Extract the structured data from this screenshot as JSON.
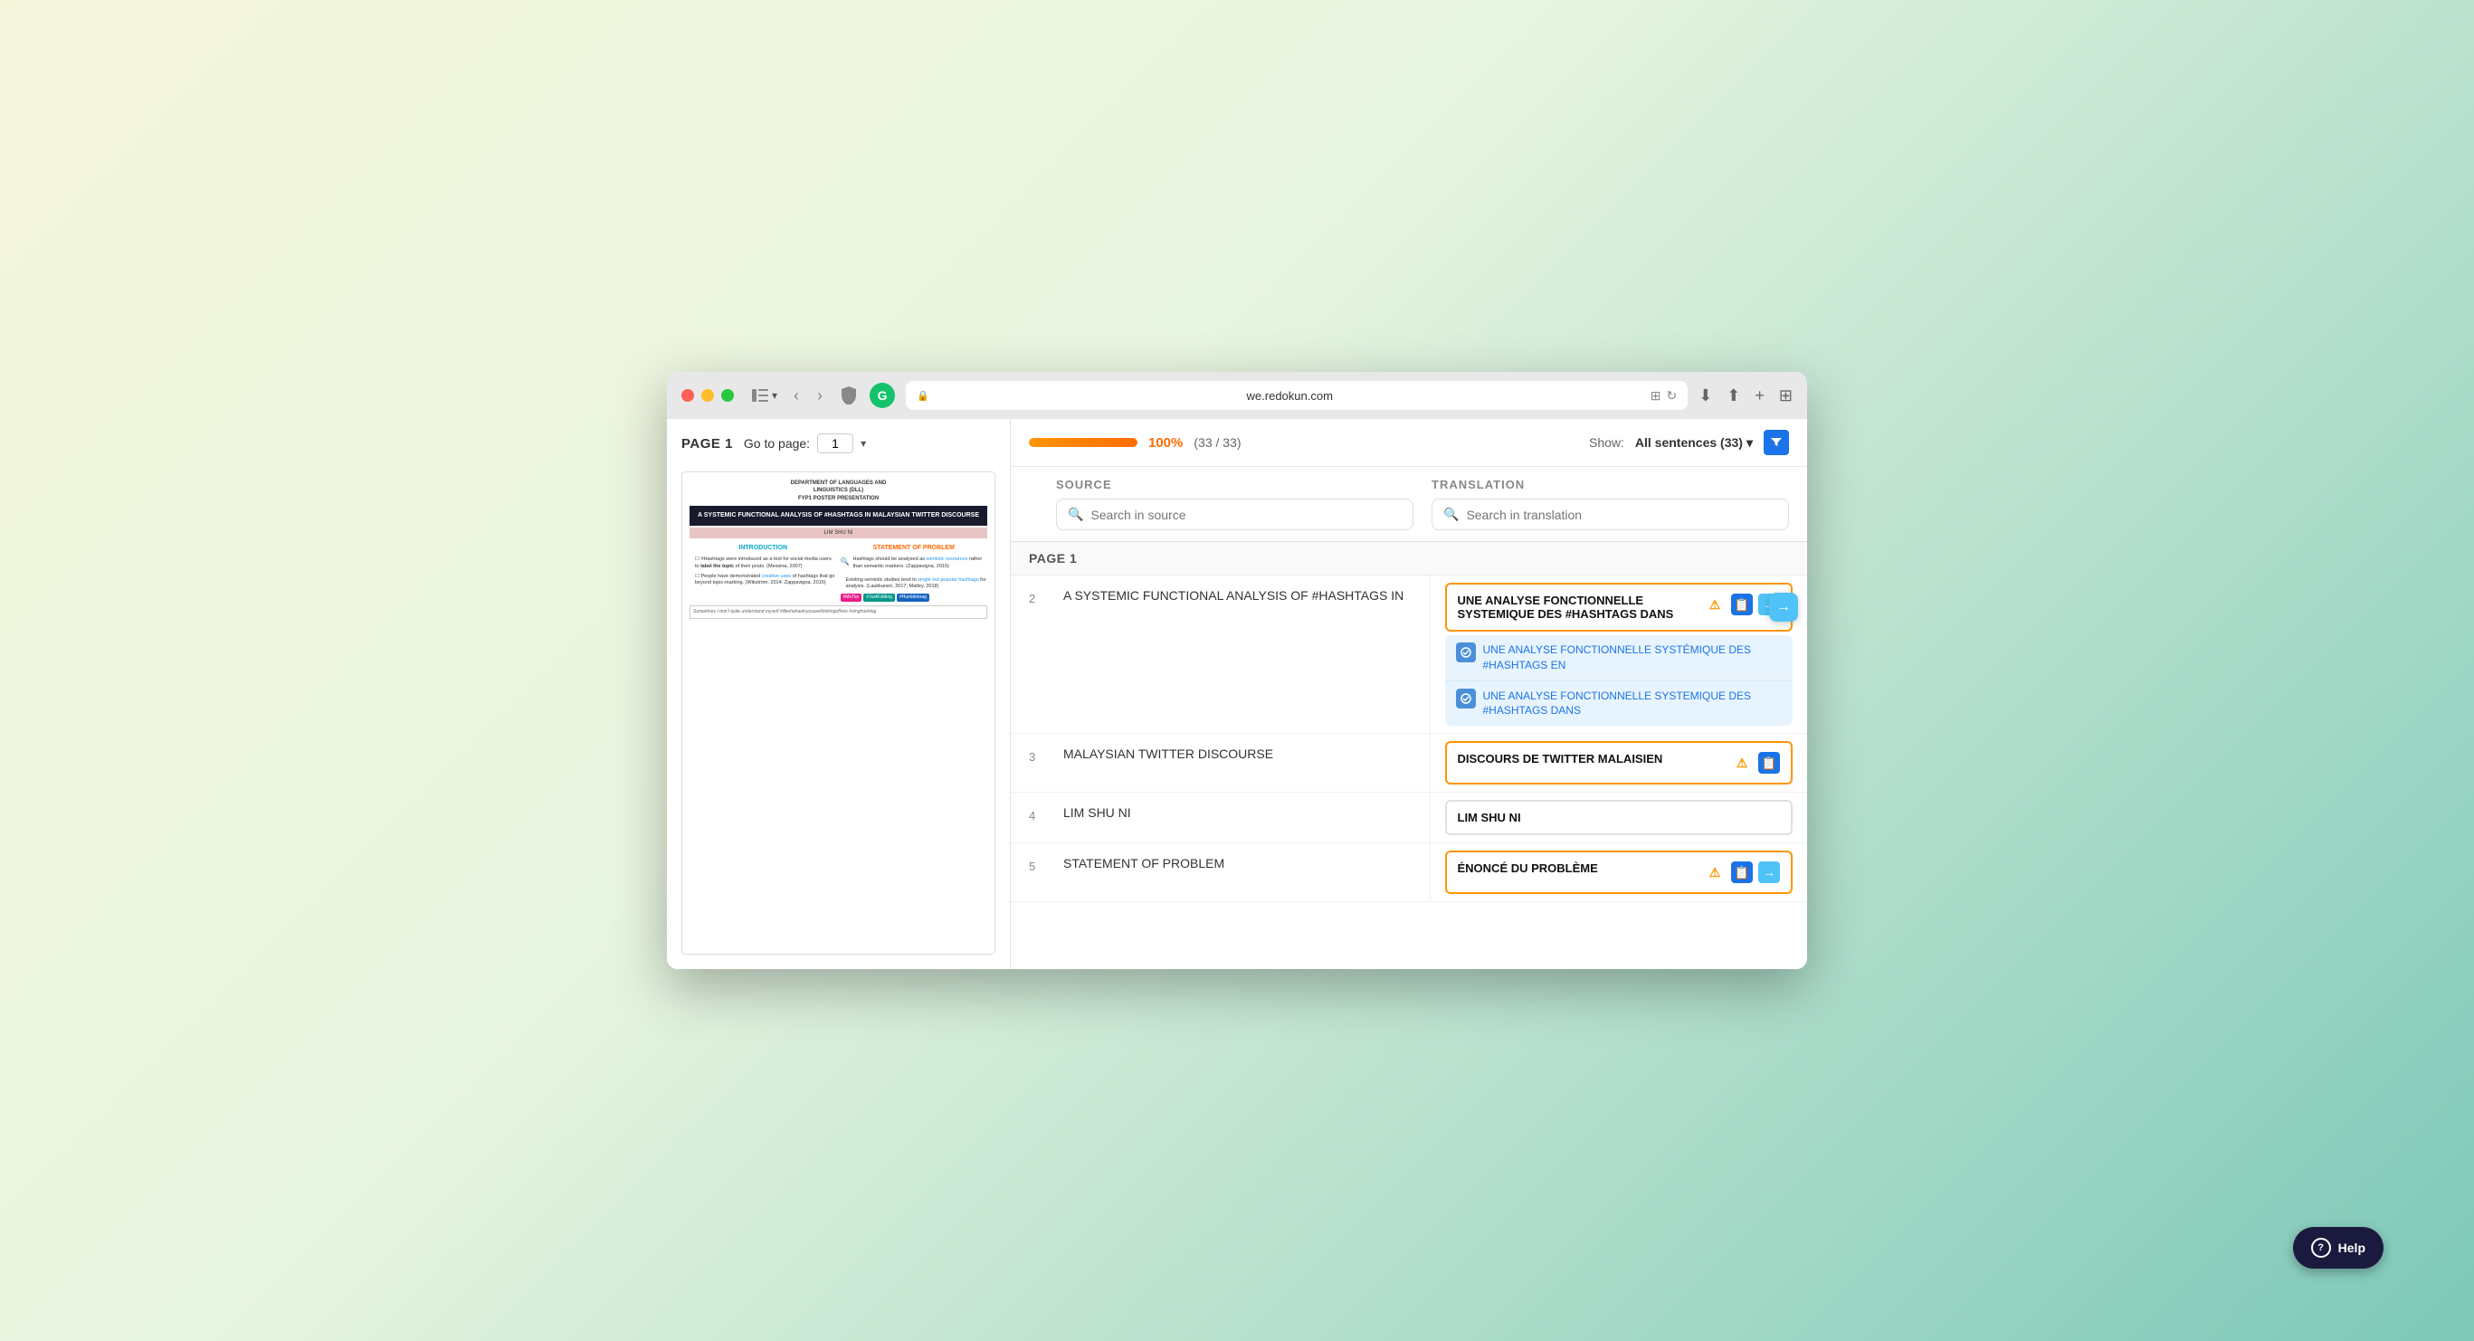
{
  "browser": {
    "url": "we.redokun.com",
    "grammarly_label": "G"
  },
  "page": {
    "label": "PAGE 1",
    "goto_label": "Go to page:",
    "goto_value": "1"
  },
  "progress": {
    "percentage": "100%",
    "fraction": "(33 / 33)"
  },
  "show": {
    "label": "Show:",
    "value": "All sentences (33)"
  },
  "columns": {
    "source_header": "SOURCE",
    "translation_header": "TRANSLATION",
    "source_placeholder": "Search in source",
    "translation_placeholder": "Search in translation"
  },
  "section": {
    "label": "PAGE 1"
  },
  "rows": [
    {
      "num": "2",
      "source": "A SYSTEMIC FUNCTIONAL ANALYSIS OF #HASHTAGS IN",
      "translation": "UNE ANALYSE FONCTIONNELLE SYSTEMIQUE DES #HASHTAGS DANS",
      "has_suggestions": true,
      "suggestions": [
        "UNE ANALYSE FONCTIONNELLE SYSTÉMIQUE DES #HASHTAGS EN",
        "UNE ANALYSE FONCTIONNELLE SYSTEMIQUE DES #HASHTAGS DANS"
      ],
      "border_color": "orange"
    },
    {
      "num": "3",
      "source": "MALAYSIAN TWITTER DISCOURSE",
      "translation": "DISCOURS DE TWITTER MALAISIEN",
      "has_suggestions": false,
      "border_color": "orange"
    },
    {
      "num": "4",
      "source": "LIM SHU NI",
      "translation": "LIM SHU NI",
      "has_suggestions": false,
      "border_color": "normal"
    },
    {
      "num": "5",
      "source": "STATEMENT OF PROBLEM",
      "translation": "ÉNONCÉ DU PROBLÈME",
      "has_suggestions": false,
      "border_color": "orange"
    }
  ],
  "help_button": {
    "label": "Help"
  },
  "preview": {
    "dept_line1": "DEPARTMENT OF LANGUAGES AND",
    "dept_line2": "LINGUISTICS (DLL)",
    "dept_line3": "FYP1 POSTER PRESENTATION",
    "main_title": "A SYSTEMIC FUNCTIONAL ANALYSIS OF #HASHTAGS IN MALAYSIAN TWITTER DISCOURSE",
    "author": "LIM SHU NI",
    "intro_title": "INTRODUCTION",
    "problem_title": "STATEMENT OF PROBLEM",
    "bullet1": "#Hashtags were introduced as a tool for social media users to label the topic of their posts. (Messina, 2007)",
    "bullet2": "People have demonstrated creative uses of hashtags that go beyond topic-marking. (Wikström, 2014; Zappavigna, 2015)",
    "problem1": "Hashtags should be analysed as semiotic resources rather than semantic markers. (Zappavigna, 2015)",
    "problem2": "Existing semiotic studies tend to single out popular hashtags for analysis. (Laukkanen, 2017; Matley, 2018)",
    "footer_note": "Sometimes I don't quite understand myself #ilikehahaetcyouarethinkingofhow #omghashtag"
  }
}
